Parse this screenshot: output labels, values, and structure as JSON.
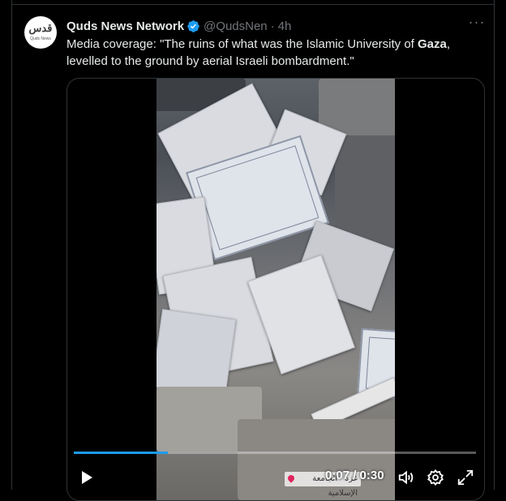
{
  "tweet": {
    "author_name": "Quds News Network",
    "handle": "@QudsNen",
    "separator": "·",
    "time": "4h",
    "avatar_logo_text": "قدس",
    "avatar_sub_text": "Quds News",
    "text_before": "Media coverage: \"The ruins of what was the Islamic University of ",
    "text_bold": "Gaza",
    "text_after": ", levelled to the ground by aerial Israeli bombardment.\"",
    "more_icon": "more-dots-icon",
    "verified_icon": "verified-badge-icon"
  },
  "video": {
    "current_time": "0:07",
    "separator": " / ",
    "duration": "0:30",
    "progress": 0.233,
    "location_tag": "غزة · الجامعة الإسلامية",
    "controls": [
      "play-icon",
      "volume-icon",
      "settings-icon",
      "fullscreen-icon"
    ]
  },
  "colors": {
    "accent": "#1d9bf0",
    "background": "#000000",
    "secondary_text": "#71767b",
    "border": "#2f3336"
  }
}
